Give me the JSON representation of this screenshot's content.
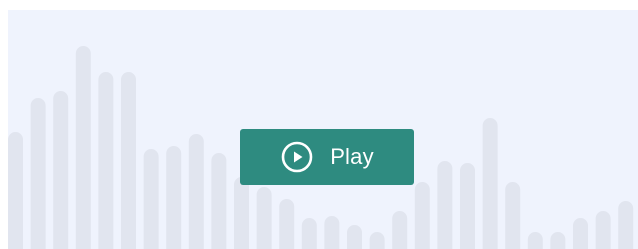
{
  "player": {
    "play_label": "Play",
    "play_icon": "play-circle-icon",
    "accent_color": "#2e8b80",
    "background_color": "#eff3fd",
    "waveform_color": "#e1e5ef",
    "waveform_levels": [
      0.49,
      0.63,
      0.66,
      0.85,
      0.74,
      0.74,
      0.42,
      0.43,
      0.48,
      0.4,
      0.3,
      0.26,
      0.21,
      0.13,
      0.14,
      0.1,
      0.07,
      0.16,
      0.28,
      0.37,
      0.36,
      0.55,
      0.28,
      0.07,
      0.07,
      0.13,
      0.16,
      0.2
    ]
  }
}
